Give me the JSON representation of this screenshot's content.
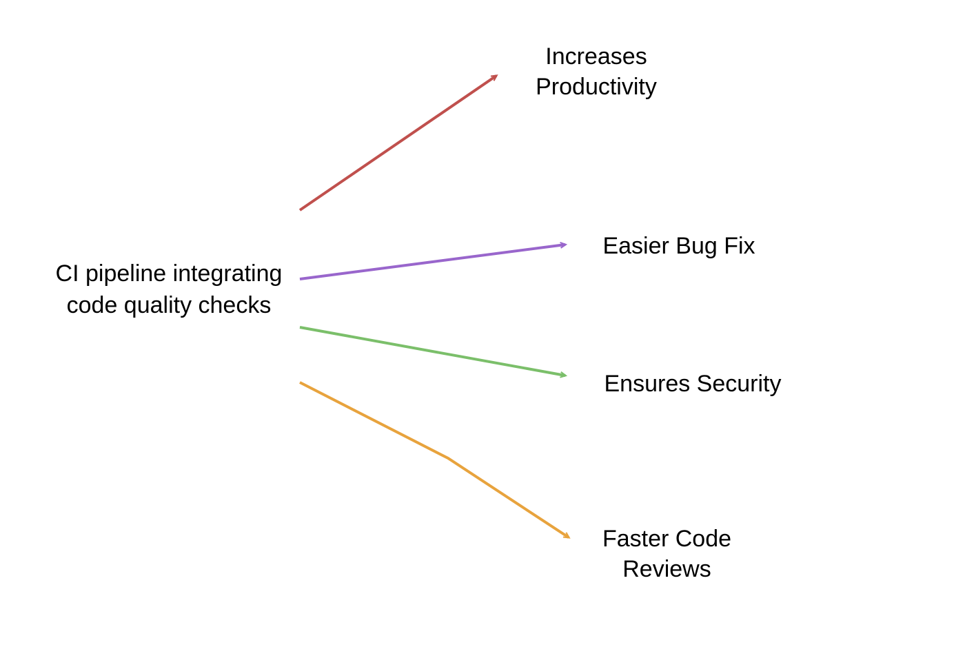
{
  "diagram": {
    "source": "CI pipeline integrating\ncode quality checks",
    "targets": [
      {
        "label": "Increases\nProductivity",
        "color": "#c0504d"
      },
      {
        "label": "Easier Bug Fix",
        "color": "#9966cc"
      },
      {
        "label": "Ensures Security",
        "color": "#7bbf6a"
      },
      {
        "label": "Faster Code\nReviews",
        "color": "#e8a33d"
      }
    ]
  }
}
